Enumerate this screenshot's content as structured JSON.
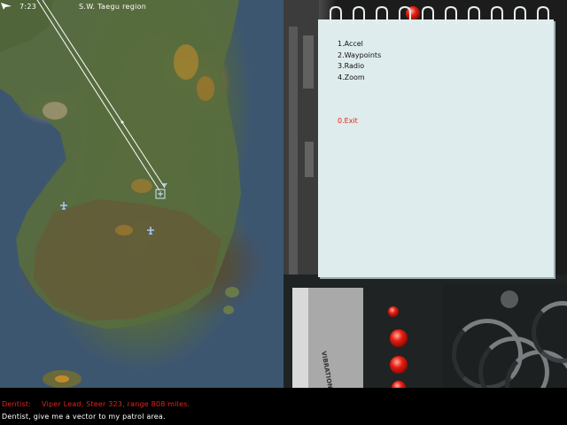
{
  "map": {
    "time": "7:23",
    "region": "S.W. Taegu region"
  },
  "menu": {
    "items": [
      {
        "label": "1.Accel"
      },
      {
        "label": "2.Waypoints"
      },
      {
        "label": "3.Radio"
      },
      {
        "label": "4.Zoom"
      }
    ],
    "exit_label": "0.Exit"
  },
  "cockpit": {
    "panel_label": "VIBRATION"
  },
  "messages": {
    "line1": {
      "speaker": "Dentist:",
      "text": "Viper Lead, Steer 323, range 808 miles."
    },
    "line2": "Dentist, give me a vector to my patrol area."
  },
  "colors": {
    "alert_text": "#e8231a",
    "normal_text": "#ffffff",
    "notepad": "#dfeced"
  }
}
